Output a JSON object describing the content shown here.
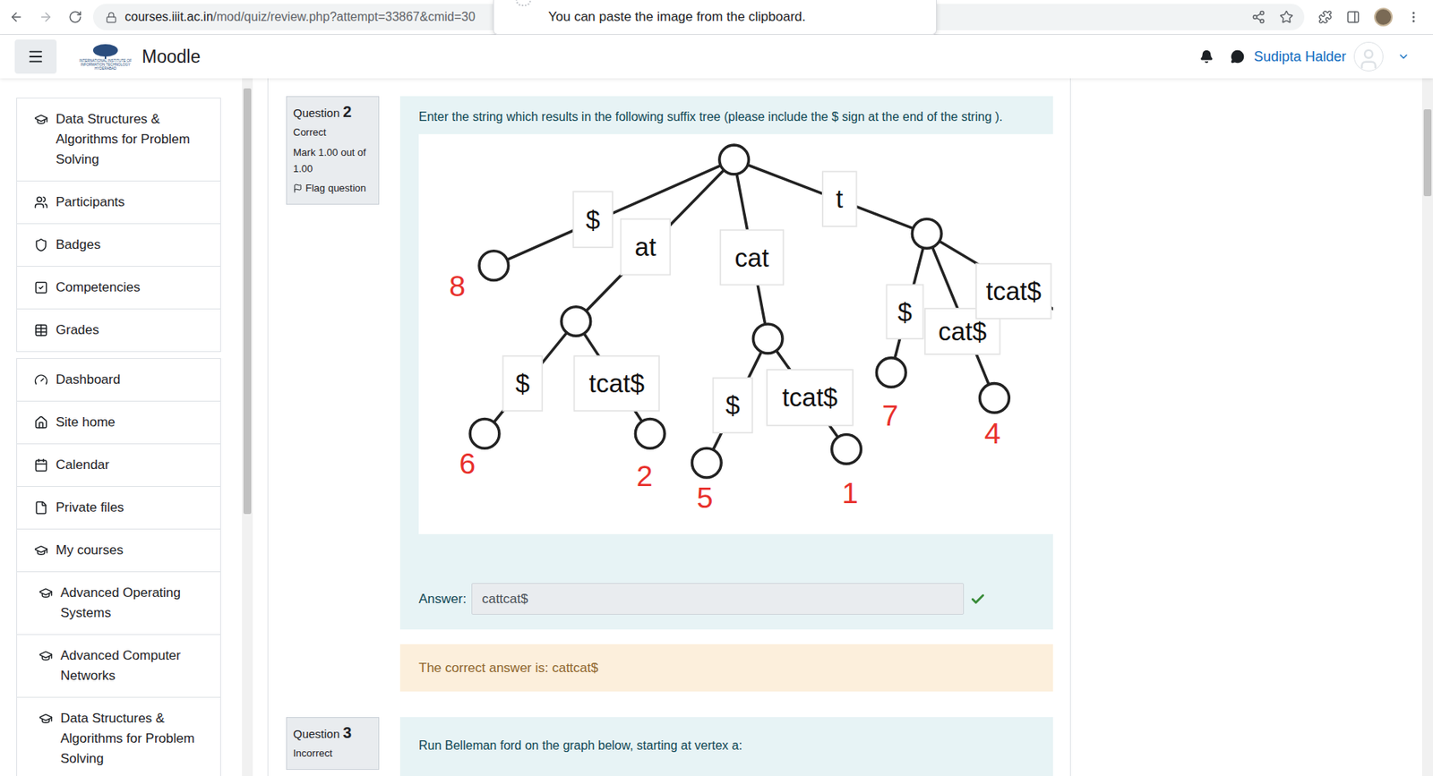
{
  "browser": {
    "url_host": "courses.iiit.ac.in",
    "url_path": "/mod/quiz/review.php?attempt=33867&cmid=30",
    "popup": "You can paste the image from the clipboard."
  },
  "navbar": {
    "logo_text": [
      "INTERNATIONAL INSTITUTE OF",
      "INFORMATION TECHNOLOGY",
      "HYDERABAD"
    ],
    "brand": "Moodle",
    "user": "Sudipta Halder"
  },
  "sidebar": {
    "groups": [
      [
        {
          "label": "Data Structures & Algorithms for Problem Solving",
          "nested": false
        },
        {
          "label": "Participants",
          "nested": false
        },
        {
          "label": "Badges",
          "nested": false
        },
        {
          "label": "Competencies",
          "nested": false
        },
        {
          "label": "Grades",
          "nested": false
        }
      ],
      [
        {
          "label": "Dashboard",
          "nested": false
        },
        {
          "label": "Site home",
          "nested": false
        },
        {
          "label": "Calendar",
          "nested": false
        },
        {
          "label": "Private files",
          "nested": false
        },
        {
          "label": "My courses",
          "nested": false
        },
        {
          "label": "Advanced Operating Systems",
          "nested": true
        },
        {
          "label": "Advanced Computer Networks",
          "nested": true
        },
        {
          "label": "Data Structures & Algorithms for Problem Solving",
          "nested": true
        }
      ]
    ]
  },
  "question": {
    "label": "Question",
    "number": "2",
    "status": "Correct",
    "mark": "Mark 1.00 out of 1.00",
    "flag": "Flag question",
    "text": "Enter the string which results in the following suffix tree (please include the $ sign at the end of the string ).",
    "answer_label": "Answer:",
    "answer": "cattcat$",
    "correct": true,
    "feedback": "The correct answer is: cattcat$"
  },
  "tree": {
    "edges": [
      {
        "label": "$"
      },
      {
        "label": "at"
      },
      {
        "label": "cat"
      },
      {
        "label": "t"
      },
      {
        "label": "$"
      },
      {
        "label": "tcat$"
      },
      {
        "label": "$"
      },
      {
        "label": "tcat$"
      },
      {
        "label": "$"
      },
      {
        "label": "cat$"
      },
      {
        "label": "tcat$"
      }
    ],
    "leaves": [
      {
        "number": "8"
      },
      {
        "number": "6"
      },
      {
        "number": "2"
      },
      {
        "number": "5"
      },
      {
        "number": "1"
      },
      {
        "number": "7"
      },
      {
        "number": "4"
      }
    ]
  },
  "next_question": {
    "label": "Question",
    "number": "3",
    "status": "Incorrect",
    "text": "Run Belleman ford on the graph below, starting at vertex a:"
  }
}
